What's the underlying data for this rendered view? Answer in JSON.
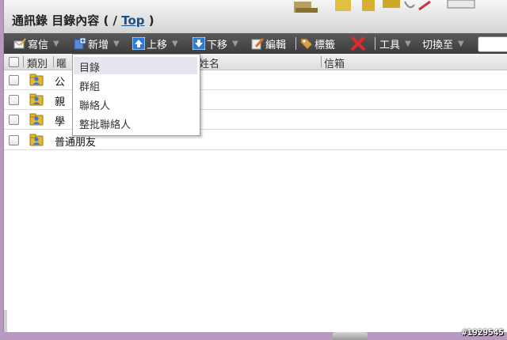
{
  "header": {
    "title_prefix": "通訊錄 目錄內容 ( / ",
    "title_link": "Top",
    "title_suffix": " )"
  },
  "toolbar": {
    "write": "寫信",
    "add": "新增",
    "move_up": "上移",
    "move_down": "下移",
    "edit": "編輯",
    "tag": "標籤",
    "tools": "工具",
    "switch_to": "切換至"
  },
  "columns": {
    "type": "類別",
    "nickname": "暱",
    "name": "姓名",
    "mailbox": "信箱"
  },
  "rows": [
    {
      "name": "公"
    },
    {
      "name": "親"
    },
    {
      "name": "學"
    },
    {
      "name": "普通朋友"
    }
  ],
  "add_menu": {
    "items": [
      "目錄",
      "群組",
      "聯絡人",
      "整批聯絡人"
    ],
    "highlighted": "目錄"
  },
  "watermark": "#1929545",
  "colors": {
    "toolbar_bg": "#4a4a4a",
    "title_link": "#1a4f8a",
    "page_bg": "#b89ac0"
  }
}
